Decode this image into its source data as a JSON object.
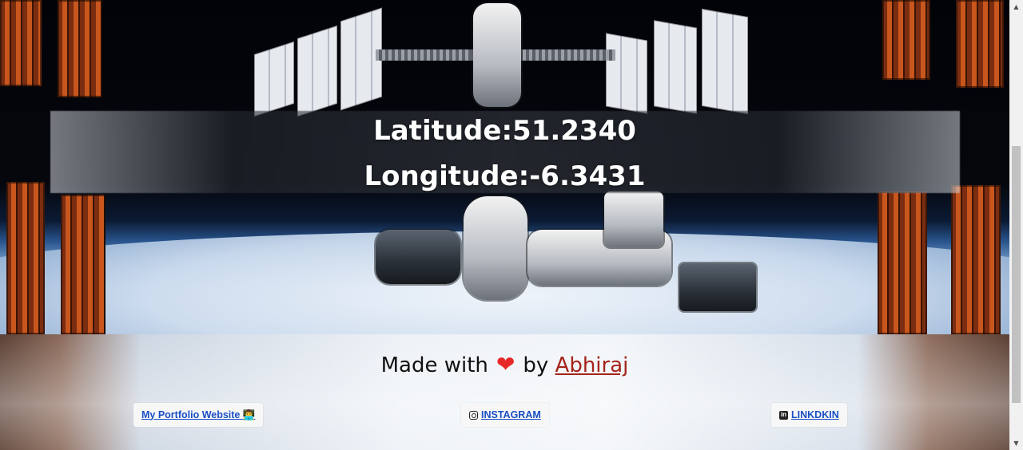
{
  "hero": {
    "latitude_label": "Latitude:51.2340",
    "longitude_label": "Longitude:-6.3431"
  },
  "footer": {
    "made_prefix": "Made with",
    "heart_glyph": "❤",
    "made_by": "by",
    "author": "Abhiraj",
    "links": [
      {
        "label": "My Portfolio Website",
        "emoji": "👨‍💻",
        "icon": "coder-emoji"
      },
      {
        "label": "INSTAGRAM",
        "icon": "instagram-icon"
      },
      {
        "label": "LINKDKIN",
        "icon": "linkedin-icon"
      }
    ]
  },
  "colors": {
    "heart": "#e62828",
    "author_link": "#a4231a",
    "nav_link": "#1a4fc6"
  },
  "scrollbar": {
    "up_arrow": "▲",
    "down_arrow": "▼"
  }
}
